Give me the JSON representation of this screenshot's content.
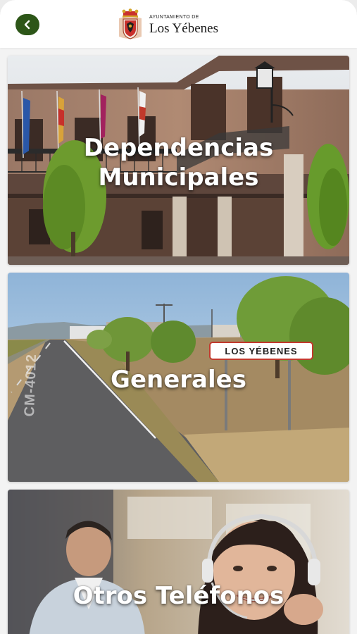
{
  "header": {
    "back_icon": "chevron-left-icon",
    "logo_small": "AYUNTAMIENTO DE",
    "logo_big": "Los Yébenes",
    "brand_color": "#2d5618"
  },
  "cards": [
    {
      "label": "Dependencias\nMunicipales"
    },
    {
      "label": "Generales",
      "sign_text": "LOS YÉBENES",
      "road_text": "CM-4012"
    },
    {
      "label": "Otros Teléfonos"
    }
  ]
}
